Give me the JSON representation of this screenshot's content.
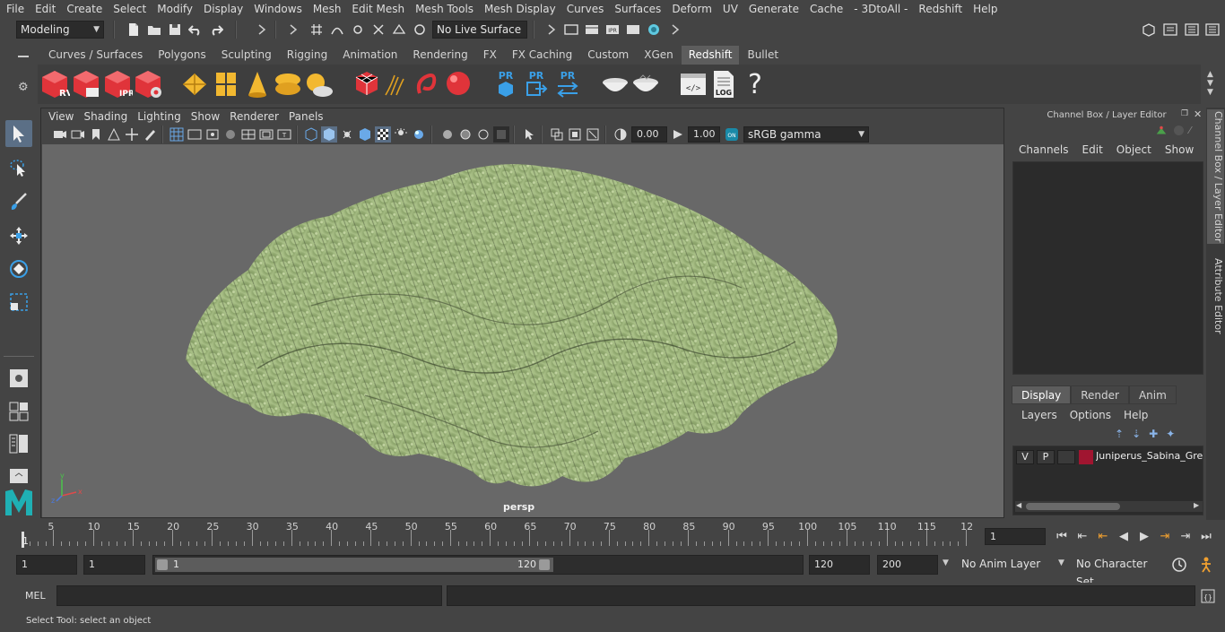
{
  "menubar": {
    "items": [
      "File",
      "Edit",
      "Create",
      "Select",
      "Modify",
      "Display",
      "Windows",
      "Mesh",
      "Edit Mesh",
      "Mesh Tools",
      "Mesh Display",
      "Curves",
      "Surfaces",
      "Deform",
      "UV",
      "Generate",
      "Cache",
      "- 3DtoAll -",
      "Redshift",
      "Help"
    ]
  },
  "statusline": {
    "workspace": "Modeling",
    "live_surface": "No Live Surface"
  },
  "shelf": {
    "tabs": [
      "Curves / Surfaces",
      "Polygons",
      "Sculpting",
      "Rigging",
      "Animation",
      "Rendering",
      "FX",
      "FX Caching",
      "Custom",
      "XGen",
      "Redshift",
      "Bullet"
    ],
    "active_tab": "Redshift",
    "labels": {
      "rv": "RV",
      "ipr": "IPR",
      "pr1": "PR",
      "pr2": "PR",
      "pr3": "PR",
      "log": "LOG",
      "help": "?"
    }
  },
  "viewport": {
    "menu": [
      "View",
      "Shading",
      "Lighting",
      "Show",
      "Renderer",
      "Panels"
    ],
    "exposure": "0.00",
    "gamma": "1.00",
    "color_space": "sRGB gamma",
    "camera": "persp"
  },
  "channel_box": {
    "title": "Channel Box / Layer Editor",
    "menu": [
      "Channels",
      "Edit",
      "Object",
      "Show"
    ],
    "layer_tabs": [
      "Display",
      "Render",
      "Anim"
    ],
    "active_layer_tab": "Display",
    "layer_menu": [
      "Layers",
      "Options",
      "Help"
    ],
    "layer": {
      "v": "V",
      "p": "P",
      "name": "Juniperus_Sabina_Gre",
      "color": "#a01530"
    }
  },
  "side_tabs": [
    "Channel Box / Layer Editor",
    "Attribute Editor"
  ],
  "timeslider": {
    "ticks": [
      "5",
      "10",
      "15",
      "20",
      "25",
      "30",
      "35",
      "40",
      "45",
      "50",
      "55",
      "60",
      "65",
      "70",
      "75",
      "80",
      "85",
      "90",
      "95",
      "100",
      "105",
      "110",
      "115",
      "12"
    ],
    "start_label": "1",
    "current_frame": "1"
  },
  "range": {
    "start": "1",
    "playback_start": "1",
    "range_start_label": "1",
    "range_end_label": "120",
    "playback_end": "120",
    "end": "200",
    "anim_layer": "No Anim Layer",
    "character_set": "No Character Set"
  },
  "command": {
    "language": "MEL"
  },
  "help_line": "Select Tool: select an object",
  "colors": {
    "accent": "#5b6f86",
    "redshift_red": "#e0343a",
    "shelf_yellow": "#f2b830"
  }
}
